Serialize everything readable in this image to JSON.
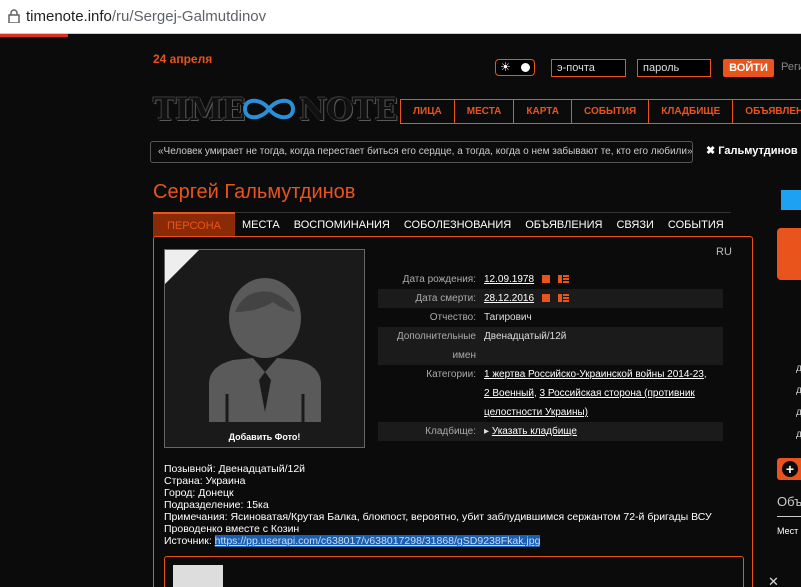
{
  "browser": {
    "url_host": "timenote.info",
    "url_path": "/ru/Sergej-Galmutdinov"
  },
  "header": {
    "date": "24 апреля",
    "email_placeholder": "э-почта",
    "password_placeholder": "пароль",
    "login_label": "ВОЙТИ",
    "register_label": "Реги"
  },
  "logo": {
    "left": "TIME",
    "right": "NOTE"
  },
  "nav": [
    "ЛИЦА",
    "МЕСТА",
    "КАРТА",
    "СОБЫТИЯ",
    "КЛАДБИЩЕ",
    "ОБЪЯВЛЕНИЯ"
  ],
  "quote": "«Человек умирает не тогда, когда перестает биться его сердце, а тогда, когда о нем забывают те, кто его любили»",
  "tag_chip": "✖ Гальмутдинов С",
  "person": {
    "name": "Сергей Гальмутдинов"
  },
  "tabs": [
    "ПЕРСОНА",
    "МЕСТА",
    "ВОСПОМИНАНИЯ",
    "СОБОЛЕЗНОВАНИЯ",
    "ОБЪЯВЛЕНИЯ",
    "СВЯЗИ",
    "СОБЫТИЯ"
  ],
  "lang": "RU",
  "photo": {
    "add_label": "Добавить Фото!"
  },
  "info": {
    "birth_label": "Дата рождения:",
    "birth_value": "12.09.1978",
    "death_label": "Дата смерти:",
    "death_value": "28.12.2016",
    "patronymic_label": "Отчество:",
    "patronymic_value": "Тагирович",
    "extra_label": "Дополнительные имен",
    "extra_value": "Двенадцатый/12й",
    "categories_label": "Категории:",
    "cat1": "1 жертва Российско-Украинской войны 2014-23",
    "cat1_sep": ",",
    "cat2": "2 Военный",
    "cat2_sep": ",",
    "cat3": "3 Российская сторона (противник целостности Украины)",
    "cemetery_label": "Кладбище:",
    "cemetery_value": "Указать кладбище"
  },
  "bio": {
    "callsign": "Позывной: Двенадцатый/12й",
    "country": "Страна: Украина",
    "city": "Город: Донецк",
    "unit": "Подразделение: 15ка",
    "notes": "Примечания: Ясиноватая/Крутая Балка, блокпост, вероятно, убит заблудившимся сержантом 72-й бригады ВСУ",
    "with": "Проводенко вместе с Козин",
    "source_label": "Источник:",
    "source_url": "https://pp.userapi.com/c638017/v638017298/31868/gSD9238Fkak.jpg"
  },
  "side": {
    "ob": "Объ",
    "mest": "Мест",
    "x": "✕"
  }
}
